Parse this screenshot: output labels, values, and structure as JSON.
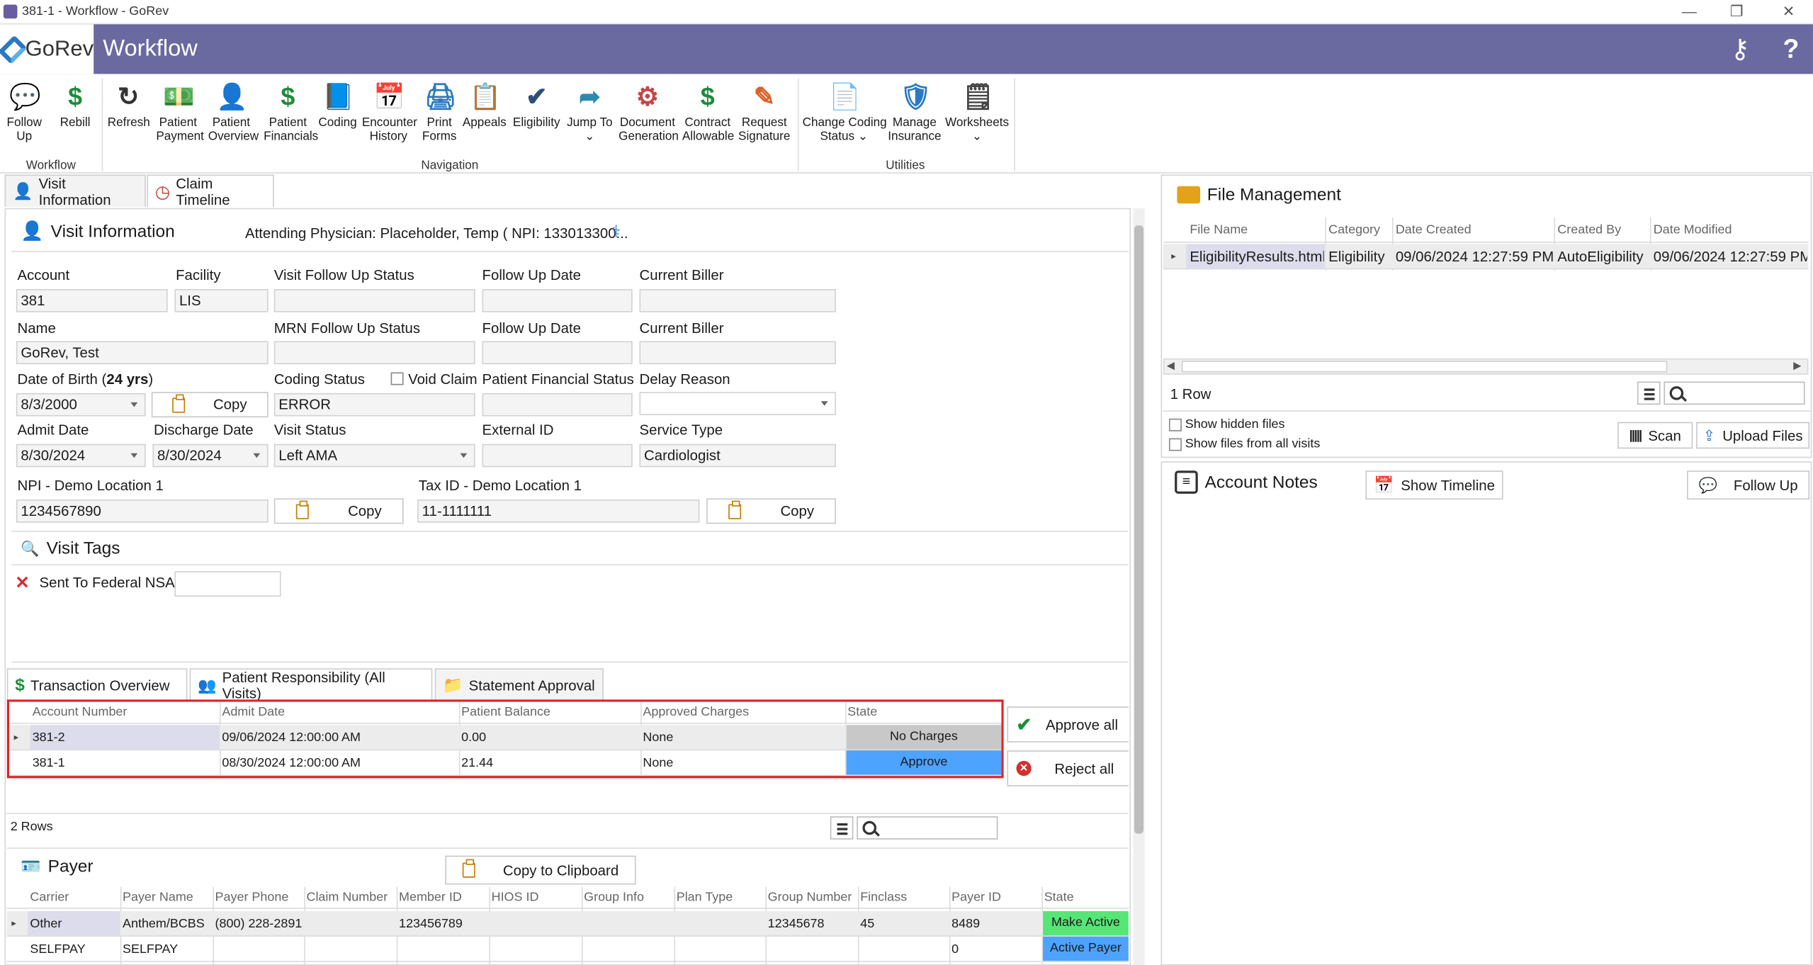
{
  "window": {
    "title": "381-1 - Workflow - GoRev",
    "minimize": "—",
    "restore": "❐",
    "close": "✕"
  },
  "app": {
    "logo": "GoRev",
    "title": "Workflow",
    "key_icon": "key-icon",
    "help": "?"
  },
  "ribbon": {
    "buttons": [
      {
        "l1": "Follow",
        "l2": "Up",
        "ic": "💬",
        "c": "#2b79c2"
      },
      {
        "l1": "Rebill",
        "l2": "",
        "ic": "$",
        "c": "#1e8c3a"
      },
      {
        "l1": "Refresh",
        "l2": "",
        "ic": "↻",
        "c": "#333"
      },
      {
        "l1": "Patient",
        "l2": "Payment",
        "ic": "💵",
        "c": "#1e8c3a"
      },
      {
        "l1": "Patient",
        "l2": "Overview",
        "ic": "👤",
        "c": "#2f6b3a"
      },
      {
        "l1": "Patient",
        "l2": "Financials",
        "ic": "$",
        "c": "#1e8c3a"
      },
      {
        "l1": "Coding",
        "l2": "",
        "ic": "📘",
        "c": "#2b79c2"
      },
      {
        "l1": "Encounter",
        "l2": "History",
        "ic": "📅",
        "c": "#444"
      },
      {
        "l1": "Print",
        "l2": "Forms",
        "ic": "🖨",
        "c": "#2b79c2"
      },
      {
        "l1": "Appeals",
        "l2": "",
        "ic": "📋",
        "c": "#2b79c2"
      },
      {
        "l1": "Eligibility",
        "l2": "",
        "ic": "✔",
        "c": "#2f4f7a"
      },
      {
        "l1": "Jump To",
        "l2": "⌄",
        "ic": "➦",
        "c": "#2b8ab0"
      },
      {
        "l1": "Document",
        "l2": "Generation",
        "ic": "⚙",
        "c": "#c04848"
      },
      {
        "l1": "Contract",
        "l2": "Allowable",
        "ic": "$",
        "c": "#1e8c3a"
      },
      {
        "l1": "Request",
        "l2": "Signature",
        "ic": "✎",
        "c": "#d9602a"
      },
      {
        "l1": "Change Coding",
        "l2": "Status ⌄",
        "ic": "📄",
        "c": "#444"
      },
      {
        "l1": "Manage",
        "l2": "Insurance",
        "ic": "🛡",
        "c": "#2b79c2"
      },
      {
        "l1": "Worksheets",
        "l2": "⌄",
        "ic": "🗒",
        "c": "#444"
      }
    ],
    "groups": [
      "Workflow",
      "Navigation",
      "Utilities"
    ]
  },
  "tabs": {
    "visit_information": "Visit Information",
    "claim_timeline": "Claim Timeline"
  },
  "visit": {
    "header": "Visit Information",
    "attending": "Attending Physician: Placeholder, Temp ( NPI: 133013300...",
    "labels": {
      "account": "Account",
      "facility": "Facility",
      "vfus": "Visit Follow Up Status",
      "fud1": "Follow Up Date",
      "cb1": "Current Biller",
      "name": "Name",
      "mfus": "MRN Follow Up Status",
      "fud2": "Follow Up Date",
      "cb2": "Current Biller",
      "dob": "Date of Birth (",
      "dob_age": "24 yrs",
      "dob_close": ")",
      "coding": "Coding Status",
      "void": "Void Claim",
      "pfs": "Patient Financial Status",
      "delay": "Delay Reason",
      "admit": "Admit Date",
      "discharge": "Discharge Date",
      "vstatus": "Visit Status",
      "extid": "External ID",
      "stype": "Service Type",
      "npi": "NPI - Demo Location 1",
      "taxid": "Tax ID - Demo Location 1"
    },
    "values": {
      "account": "381",
      "facility": "LIS",
      "name": "GoRev, Test",
      "dob": "8/3/2000",
      "coding": "ERROR",
      "admit": "8/30/2024",
      "discharge": "8/30/2024",
      "vstatus": "Left AMA",
      "stype": "Cardiologist",
      "npi": "1234567890",
      "taxid": "11-1111111"
    },
    "copy": "Copy"
  },
  "tags": {
    "header": "Visit Tags",
    "item": "Sent To Federal NSA"
  },
  "tabs2": {
    "t1": "Transaction Overview",
    "t2": "Patient Responsibility (All Visits)",
    "t3": "Statement Approval"
  },
  "statement": {
    "columns": [
      "Account Number",
      "Admit Date",
      "Patient Balance",
      "Approved Charges",
      "State"
    ],
    "rows": [
      [
        "381-2",
        "09/06/2024 12:00:00 AM",
        "0.00",
        "None",
        "No Charges"
      ],
      [
        "381-1",
        "08/30/2024 12:00:00 AM",
        "21.44",
        "None",
        "Approve"
      ]
    ],
    "count": "2 Rows",
    "approve_all": "Approve all",
    "reject_all": "Reject all"
  },
  "payer": {
    "header": "Payer",
    "copy": "Copy to Clipboard",
    "columns": [
      "Carrier",
      "Payer Name",
      "Payer Phone",
      "Claim Number",
      "Member ID",
      "HIOS ID",
      "Group Info",
      "Plan Type",
      "Group Number",
      "Finclass",
      "Payer ID",
      "State"
    ],
    "rows": [
      [
        "Other",
        "Anthem/BCBS",
        "(800) 228-2891",
        "",
        "123456789",
        "",
        "",
        "",
        "12345678",
        "45",
        "8489",
        "Make Active"
      ],
      [
        "SELFPAY",
        "SELFPAY",
        "",
        "",
        "",
        "",
        "",
        "",
        "",
        "",
        "0",
        "Active Payer"
      ]
    ]
  },
  "files": {
    "header": "File Management",
    "columns": [
      "File Name",
      "Category",
      "Date Created",
      "Created By",
      "Date Modified"
    ],
    "row": [
      "EligibilityResults.html",
      "Eligibility",
      "09/06/2024 12:27:59 PM",
      "AutoEligibility",
      "09/06/2024 12:27:59 PM"
    ],
    "count": "1 Row",
    "show_hidden": "Show hidden files",
    "show_all": "Show files from all visits",
    "scan": "Scan",
    "upload": "Upload Files"
  },
  "notes": {
    "header": "Account Notes",
    "timeline": "Show Timeline",
    "followup": "Follow Up"
  },
  "colors": {
    "appbar": "#6a69a0",
    "approve": "#4da3ff",
    "nocharges": "#c8c8c8",
    "make_active": "#55e676",
    "active_payer": "#4da3ff",
    "highlight": "#e0232a"
  }
}
